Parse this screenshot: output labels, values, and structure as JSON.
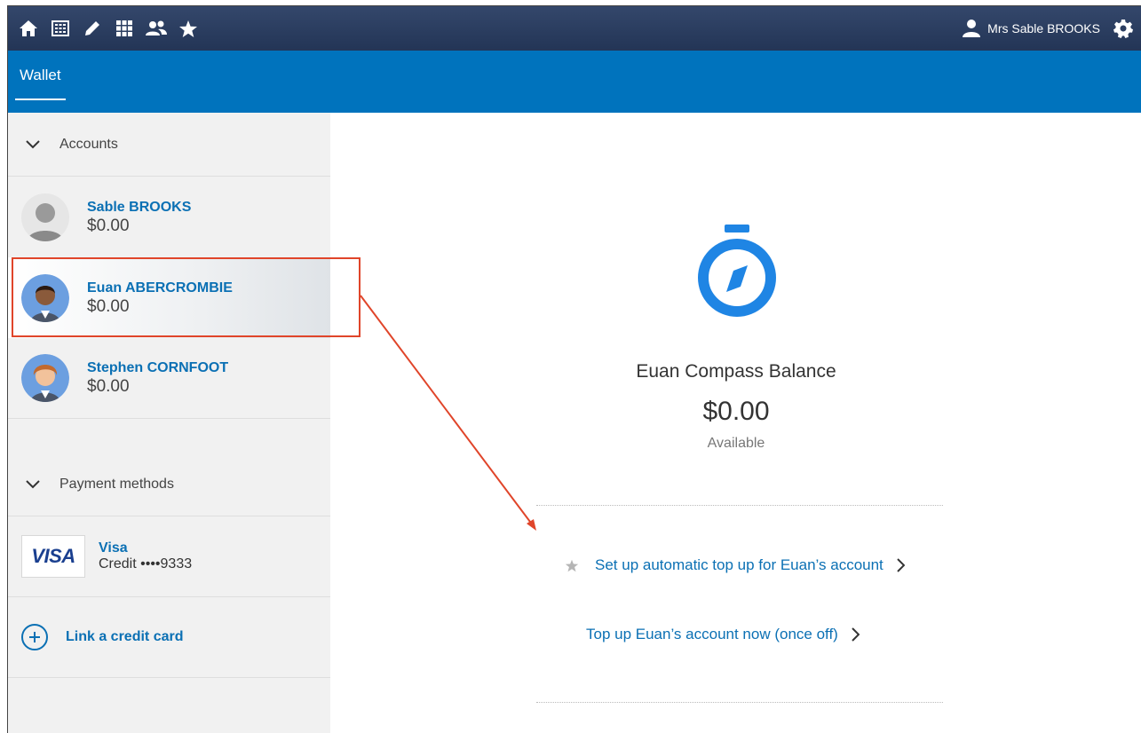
{
  "topbar": {
    "icons": [
      "home-icon",
      "calendar-icon",
      "pencil-icon",
      "grid-icon",
      "people-icon",
      "star-icon"
    ],
    "user_name": "Mrs Sable BROOKS"
  },
  "tabstrip": {
    "tab_label": "Wallet"
  },
  "sidebar": {
    "accounts_header": "Accounts",
    "accounts": [
      {
        "name": "Sable BROOKS",
        "balance": "$0.00"
      },
      {
        "name": "Euan ABERCROMBIE",
        "balance": "$0.00"
      },
      {
        "name": "Stephen CORNFOOT",
        "balance": "$0.00"
      }
    ],
    "payment_header": "Payment methods",
    "payment": {
      "brand_logo": "VISA",
      "title": "Visa",
      "detail": "Credit ••••9333"
    },
    "link_card_label": "Link a credit card"
  },
  "main": {
    "balance_title": "Euan Compass Balance",
    "balance_value": "$0.00",
    "balance_status": "Available",
    "action_auto": "Set up automatic top up for Euan’s account",
    "action_once": "Top up Euan’s account now (once off)"
  },
  "colors": {
    "topbar": "#2c3e5f",
    "tabstrip": "#0073bd",
    "link": "#0b70b4",
    "annotation": "#e0452a",
    "stopwatch": "#1f85e4"
  }
}
